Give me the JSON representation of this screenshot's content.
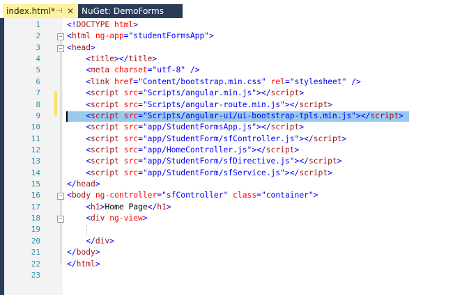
{
  "tabs": [
    {
      "label": "index.html*",
      "pin": "⊣",
      "close": "✕"
    },
    {
      "label": "NuGet: DemoForms"
    }
  ],
  "highlight_line": 9,
  "lines": [
    [
      [
        "d",
        "<!"
      ],
      [
        "e",
        "DOCTYPE"
      ],
      [
        "t",
        " "
      ],
      [
        "a",
        "html"
      ],
      [
        "d",
        ">"
      ]
    ],
    [
      [
        "d",
        "<"
      ],
      [
        "e",
        "html"
      ],
      [
        "t",
        " "
      ],
      [
        "a",
        "ng-app"
      ],
      [
        "d",
        "="
      ],
      [
        "v",
        "\"studentFormsApp\""
      ],
      [
        "d",
        ">"
      ]
    ],
    [
      [
        "d",
        "<"
      ],
      [
        "e",
        "head"
      ],
      [
        "d",
        ">"
      ]
    ],
    [
      [
        "t",
        "    "
      ],
      [
        "d",
        "<"
      ],
      [
        "e",
        "title"
      ],
      [
        "d",
        "></"
      ],
      [
        "e",
        "title"
      ],
      [
        "d",
        ">"
      ]
    ],
    [
      [
        "t",
        "    "
      ],
      [
        "d",
        "<"
      ],
      [
        "e",
        "meta"
      ],
      [
        "t",
        " "
      ],
      [
        "a",
        "charset"
      ],
      [
        "d",
        "="
      ],
      [
        "v",
        "\"utf-8\""
      ],
      [
        "t",
        " "
      ],
      [
        "d",
        "/>"
      ]
    ],
    [
      [
        "t",
        "    "
      ],
      [
        "d",
        "<"
      ],
      [
        "e",
        "link"
      ],
      [
        "t",
        " "
      ],
      [
        "a",
        "href"
      ],
      [
        "d",
        "="
      ],
      [
        "v",
        "\"Content/bootstrap.min.css\""
      ],
      [
        "t",
        " "
      ],
      [
        "a",
        "rel"
      ],
      [
        "d",
        "="
      ],
      [
        "v",
        "\"stylesheet\""
      ],
      [
        "t",
        " "
      ],
      [
        "d",
        "/>"
      ]
    ],
    [
      [
        "t",
        "    "
      ],
      [
        "d",
        "<"
      ],
      [
        "e",
        "script"
      ],
      [
        "t",
        " "
      ],
      [
        "a",
        "src"
      ],
      [
        "d",
        "="
      ],
      [
        "v",
        "\"Scripts/angular.min.js\""
      ],
      [
        "d",
        "></"
      ],
      [
        "e",
        "script"
      ],
      [
        "d",
        ">"
      ]
    ],
    [
      [
        "t",
        "    "
      ],
      [
        "d",
        "<"
      ],
      [
        "e",
        "script"
      ],
      [
        "t",
        " "
      ],
      [
        "a",
        "src"
      ],
      [
        "d",
        "="
      ],
      [
        "v",
        "\"Scripts/angular-route.min.js\""
      ],
      [
        "d",
        "></"
      ],
      [
        "e",
        "script"
      ],
      [
        "d",
        ">"
      ]
    ],
    [
      [
        "t",
        "    "
      ],
      [
        "d",
        "<"
      ],
      [
        "e",
        "script"
      ],
      [
        "t",
        " "
      ],
      [
        "a",
        "src"
      ],
      [
        "d",
        "="
      ],
      [
        "v",
        "\"Scripts/angular-ui/ui-bootstrap-tpls.min.js\""
      ],
      [
        "d",
        "></"
      ],
      [
        "e",
        "script"
      ],
      [
        "d",
        ">"
      ]
    ],
    [
      [
        "t",
        "    "
      ],
      [
        "d",
        "<"
      ],
      [
        "e",
        "script"
      ],
      [
        "t",
        " "
      ],
      [
        "a",
        "src"
      ],
      [
        "d",
        "="
      ],
      [
        "v",
        "\"app/StudentFormsApp.js\""
      ],
      [
        "d",
        "></"
      ],
      [
        "e",
        "script"
      ],
      [
        "d",
        ">"
      ]
    ],
    [
      [
        "t",
        "    "
      ],
      [
        "d",
        "<"
      ],
      [
        "e",
        "script"
      ],
      [
        "t",
        " "
      ],
      [
        "a",
        "src"
      ],
      [
        "d",
        "="
      ],
      [
        "v",
        "\"app/StudentForm/sfController.js\""
      ],
      [
        "d",
        "></"
      ],
      [
        "e",
        "script"
      ],
      [
        "d",
        ">"
      ]
    ],
    [
      [
        "t",
        "    "
      ],
      [
        "d",
        "<"
      ],
      [
        "e",
        "script"
      ],
      [
        "t",
        " "
      ],
      [
        "a",
        "src"
      ],
      [
        "d",
        "="
      ],
      [
        "v",
        "\"app/HomeController.js\""
      ],
      [
        "d",
        "></"
      ],
      [
        "e",
        "script"
      ],
      [
        "d",
        ">"
      ]
    ],
    [
      [
        "t",
        "    "
      ],
      [
        "d",
        "<"
      ],
      [
        "e",
        "script"
      ],
      [
        "t",
        " "
      ],
      [
        "a",
        "src"
      ],
      [
        "d",
        "="
      ],
      [
        "v",
        "\"app/StudentForm/sfDirective.js\""
      ],
      [
        "d",
        "></"
      ],
      [
        "e",
        "script"
      ],
      [
        "d",
        ">"
      ]
    ],
    [
      [
        "t",
        "    "
      ],
      [
        "d",
        "<"
      ],
      [
        "e",
        "script"
      ],
      [
        "t",
        " "
      ],
      [
        "a",
        "src"
      ],
      [
        "d",
        "="
      ],
      [
        "v",
        "\"app/StudentForm/sfService.js\""
      ],
      [
        "d",
        "></"
      ],
      [
        "e",
        "script"
      ],
      [
        "d",
        ">"
      ]
    ],
    [
      [
        "d",
        "</"
      ],
      [
        "e",
        "head"
      ],
      [
        "d",
        ">"
      ]
    ],
    [
      [
        "d",
        "<"
      ],
      [
        "e",
        "body"
      ],
      [
        "t",
        " "
      ],
      [
        "a",
        "ng-controller"
      ],
      [
        "d",
        "="
      ],
      [
        "v",
        "\"sfController\""
      ],
      [
        "t",
        " "
      ],
      [
        "a",
        "class"
      ],
      [
        "d",
        "="
      ],
      [
        "v",
        "\"container\""
      ],
      [
        "d",
        ">"
      ]
    ],
    [
      [
        "t",
        "    "
      ],
      [
        "d",
        "<"
      ],
      [
        "e",
        "h1"
      ],
      [
        "d",
        ">"
      ],
      [
        "t",
        "Home Page"
      ],
      [
        "d",
        "</"
      ],
      [
        "e",
        "h1"
      ],
      [
        "d",
        ">"
      ]
    ],
    [
      [
        "t",
        "    "
      ],
      [
        "d",
        "<"
      ],
      [
        "e",
        "div"
      ],
      [
        "t",
        " "
      ],
      [
        "a",
        "ng-view"
      ],
      [
        "d",
        ">"
      ]
    ],
    [],
    [
      [
        "t",
        "    "
      ],
      [
        "d",
        "</"
      ],
      [
        "e",
        "div"
      ],
      [
        "d",
        ">"
      ]
    ],
    [
      [
        "d",
        "</"
      ],
      [
        "e",
        "body"
      ],
      [
        "d",
        ">"
      ]
    ],
    [
      [
        "d",
        "</"
      ],
      [
        "e",
        "html"
      ],
      [
        "d",
        ">"
      ]
    ],
    []
  ]
}
